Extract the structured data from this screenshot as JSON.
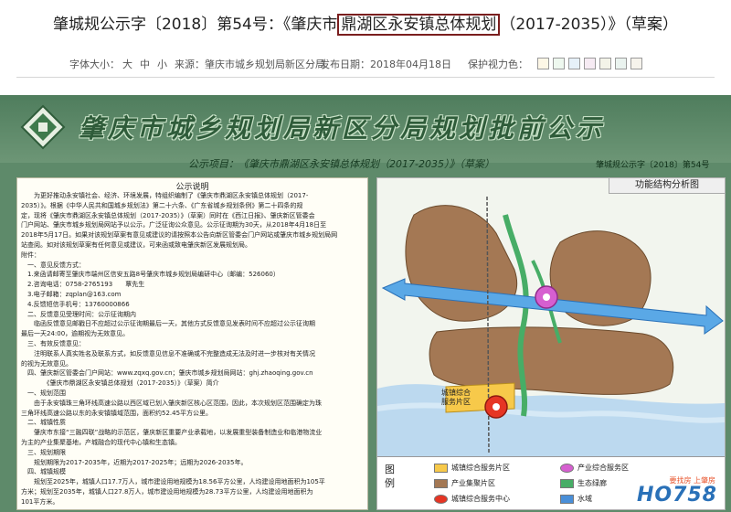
{
  "header": {
    "title_pre": "肇城规公示字〔2018〕第54号：《肇庆市",
    "title_hl": "鼎湖区永安镇总体规划",
    "title_post": "（2017-2035）》（草案）"
  },
  "meta": {
    "font_label": "字体大小：",
    "font_large": "大",
    "font_mid": "中",
    "font_small": "小",
    "source": "来源：肇庆市城乡规划局新区分局",
    "date": "发布日期：2018年04月18日",
    "eye_mode": "保护视力色：",
    "eye_colors": [
      "#fdf7e6",
      "#eef8ef",
      "#e6f1f9",
      "#f6ebf3",
      "#f3f3e8",
      "#eaf3ef",
      "#f6f3ec"
    ]
  },
  "poster": {
    "banner": "肇庆市城乡规划局新区分局规划批前公示",
    "subtitle": "公示项目：《肇庆市鼎湖区永安镇总体规划（2017-2035）》（草案）",
    "doc_no": "肇城规公示字〔2018〕第54号",
    "notice_title": "公示说明",
    "notice_lines": [
      "　　为更好推动永安镇社会、经济、环境发展，特组织编制了《肇庆市鼎湖区永安镇总体规划（2017-",
      "2035）》。根据《中华人民共和国城乡规划法》第二十六条、《广东省城乡规划条例》第二十四条的规",
      "定，现将《肇庆市鼎湖区永安镇总体规划（2017-2035）》（草案）同时在《西江日报》、肇庆新区管委会",
      "门户网站、肇庆市城乡规划局网站予以公示，广泛征询公众意见。公示征询期为30天，从2018年4月18日至",
      "2018年5月17日。如果对该规划草案有意见或建议的请按照本公告向新区管委会门户网站或肇庆市城乡规划局网",
      "站查阅。如对该规划草案有任何意见或建议，可来函或致电肇庆新区发展规划局。",
      "附件：",
      "　一、意见反馈方式：",
      "　1.来函请邮寄至肇庆市端州区信安五路8号肇庆市城乡规划局编研中心（邮编：526060）",
      "　2.咨询电话：0758-2765193　　覃先生",
      "　3.电子邮箱：zqplan@163.com",
      "　4.反馈短信手机号：13760000866",
      "　二、反馈意见受理时间：公示征询期内",
      "　　临函反馈意见邮戳日不应超过公示征询期最后一天，其他方式反馈意见发表时间不应超过公示征询期",
      "最后一天24:00，逾期视为无效意见。",
      "　三、有效反馈意见：",
      "　　注明联系人真实姓名及联系方式，如反馈意见信息不准确或不完整造成无法及时进一步核对有关情况",
      "的视为无效意见。",
      "　四、肇庆新区管委会门户网站：www.zqxq.gov.cn；肇庆市城乡规划局网站：ghj.zhaoqing.gov.cn",
      "　　　　《肇庆市鼎湖区永安镇总体规划（2017-2035）》（草案）简介",
      "　一、规划范围",
      "　　由于永安镇珠三角环线高速公路以西区域已划入肇庆新区核心区范围，因此，本次规划区范围确定为珠",
      "三角环线高速公路以东的永安镇镇域范围，面积约52.45平方公里。",
      "　二、城镇性质",
      "　　肇庆市东接“三融四联”战略的示范区，肇庆新区重要产业承载地，以发展重型装备制造业和临港物流业",
      "为主的产业集聚基地，产城融合的现代中心镇和生态镇。",
      "　三、规划期限",
      "　　规划期限为2017-2035年，近期为2017-2025年；远期为2026-2035年。",
      "　四、城镇规模",
      "　　规划至2025年，城镇人口17.7万人，城市建设用地规模为18.56平方公里，人均建设用地面积为105平",
      "方米；规划至2035年，城镇人口27.8万人，城市建设用地规模为28.73平方公里，人均建设用地面积为",
      "101平方米。"
    ],
    "map": {
      "title": "功能结构分析图",
      "label_a": "城镇综合",
      "label_b": "服务片区",
      "legend_title": "图例",
      "legend": [
        {
          "label": "城镇综合服务片区",
          "color": "#f7c94a"
        },
        {
          "label": "产业综合服务区",
          "color": "#d65fd0"
        },
        {
          "label": "产业集聚片区",
          "color": "#a47854"
        },
        {
          "label": "生态绿廊",
          "color": "#47ad66"
        },
        {
          "label": "城镇综合服务中心",
          "color": "#e63524"
        },
        {
          "label": "水域",
          "color": "#4a8fd8"
        }
      ]
    },
    "watermark": {
      "main": "HO758",
      "sub": "要找房 上肇房"
    }
  }
}
